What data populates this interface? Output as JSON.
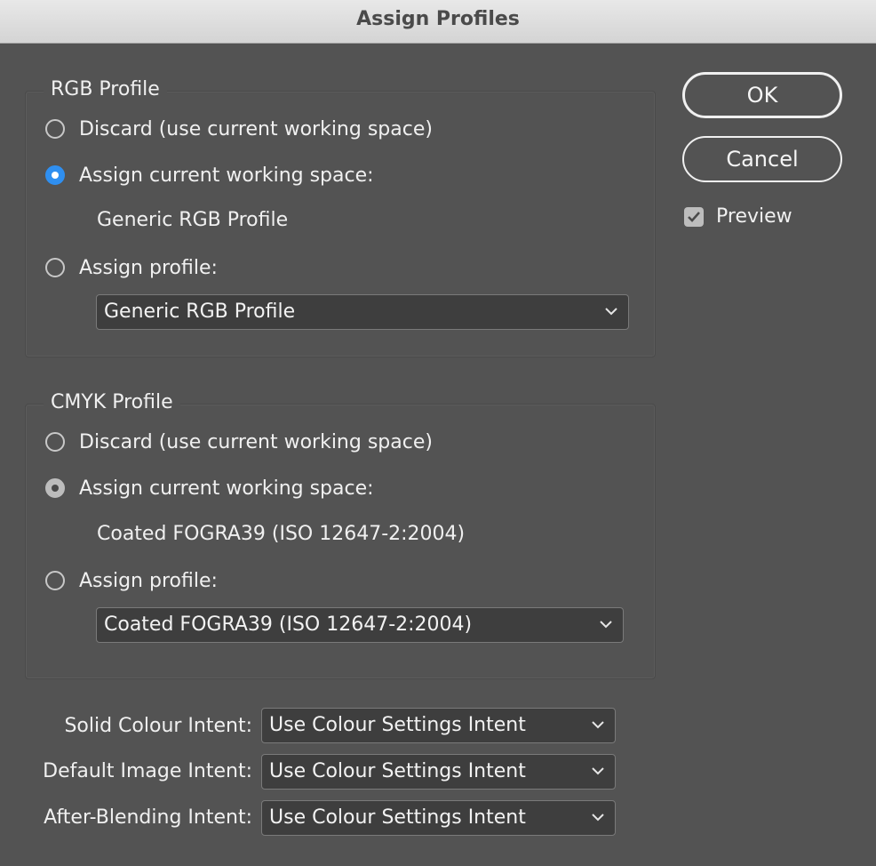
{
  "window": {
    "title": "Assign Profiles"
  },
  "rgb": {
    "group_title": "RGB Profile",
    "discard_label": "Discard (use current working space)",
    "assign_current_label": "Assign current working space:",
    "current_profile": "Generic RGB Profile",
    "assign_profile_label": "Assign profile:",
    "profile_select_value": "Generic RGB Profile",
    "selected_option": "assign_current"
  },
  "cmyk": {
    "group_title": "CMYK Profile",
    "discard_label": "Discard (use current working space)",
    "assign_current_label": "Assign current working space:",
    "current_profile": "Coated FOGRA39 (ISO 12647-2:2004)",
    "assign_profile_label": "Assign profile:",
    "profile_select_value": "Coated FOGRA39 (ISO 12647-2:2004)",
    "selected_option": "assign_current"
  },
  "buttons": {
    "ok_label": "OK",
    "cancel_label": "Cancel"
  },
  "preview": {
    "label": "Preview",
    "checked": true
  },
  "intents": {
    "solid": {
      "label": "Solid Colour Intent:",
      "value": "Use Colour Settings Intent"
    },
    "default_image": {
      "label": "Default Image Intent:",
      "value": "Use Colour Settings Intent"
    },
    "after_blending": {
      "label": "After-Blending Intent:",
      "value": "Use Colour Settings Intent"
    }
  },
  "colors": {
    "dialog_bg": "#535353",
    "accent_blue": "#2f8ff0",
    "select_bg": "#3e3e3e"
  }
}
